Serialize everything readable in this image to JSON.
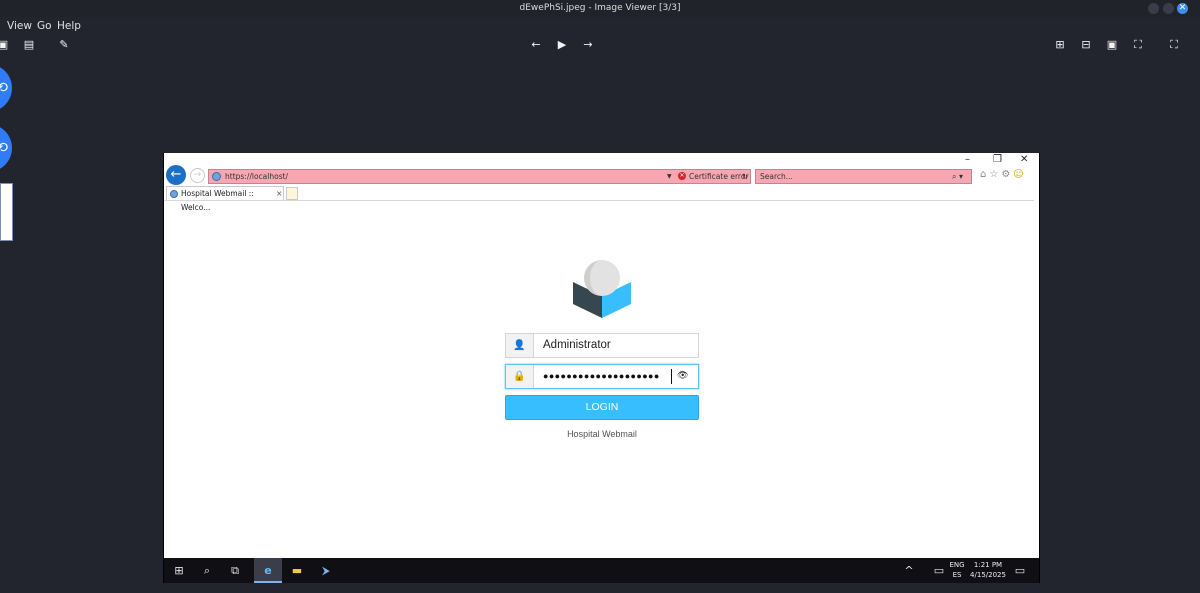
{
  "viewer": {
    "title": "dEwePhSi.jpeg - Image Viewer [3/3]",
    "menu": [
      "View",
      "Go",
      "Help"
    ],
    "close_glyph": "✕",
    "icons": {
      "save": "save-icon",
      "delete": "trash-icon",
      "edit": "pencil-icon",
      "prev": "arrow-left-icon",
      "play": "play-icon",
      "next": "arrow-right-icon",
      "zoom_in": "zoom-in-icon",
      "zoom_out": "zoom-out-icon",
      "original": "original-size-icon",
      "fit": "fit-icon",
      "fullscreen": "fullscreen-icon"
    }
  },
  "browser": {
    "window_controls": {
      "minimize": "–",
      "restore": "❐",
      "close": "✕"
    },
    "address": "https://localhost/",
    "certificate_error": "Certificate error",
    "search_placeholder": "Search...",
    "tab_title": "Hospital Webmail :: Welco...",
    "tab_close": "×"
  },
  "login": {
    "username": "Administrator",
    "password_masked": "●●●●●●●●●●●●●●●●●●●●",
    "button": "LOGIN",
    "caption": "Hospital Webmail"
  },
  "taskbar": {
    "language": "ENG",
    "layout": "ES",
    "time": "1:21 PM",
    "date": "4/15/2025"
  },
  "colors": {
    "accent_blue": "#37beff",
    "address_error": "#f8a7b2",
    "viewer_bg": "#23252e"
  }
}
